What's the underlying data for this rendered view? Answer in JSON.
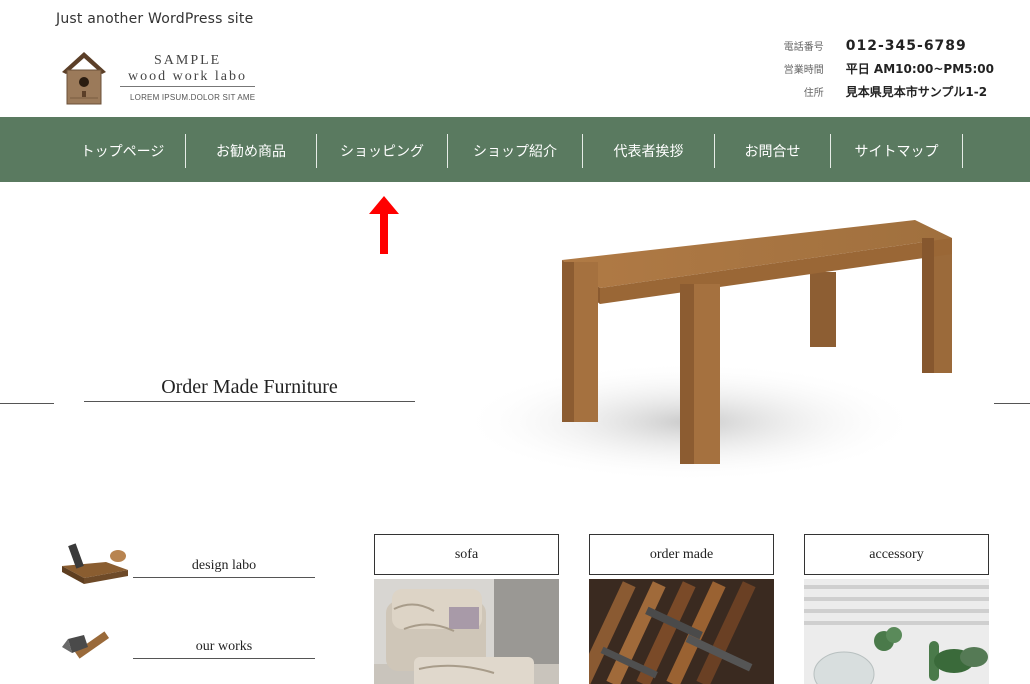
{
  "site": {
    "tagline": "Just another WordPress site",
    "logo": {
      "line1": "SAMPLE",
      "line2": "wood work labo",
      "line3": "LOREM IPSUM.DOLOR SIT AME"
    }
  },
  "contact": {
    "phone_label": "電話番号",
    "phone_value": "012-345-6789",
    "hours_label": "営業時間",
    "hours_value": "平日 AM10:00~PM5:00",
    "address_label": "住所",
    "address_value": "見本県見本市サンプル1-2"
  },
  "nav": {
    "items": [
      {
        "label": "トップページ"
      },
      {
        "label": "お勧め商品"
      },
      {
        "label": "ショッピング"
      },
      {
        "label": "ショップ紹介"
      },
      {
        "label": "代表者挨拶"
      },
      {
        "label": "お問合せ"
      },
      {
        "label": "サイトマップ"
      }
    ]
  },
  "hero": {
    "title": "Order Made Furniture"
  },
  "side_links": [
    {
      "label": "design labo"
    },
    {
      "label": "our works"
    }
  ],
  "categories": [
    {
      "label": "sofa"
    },
    {
      "label": "order made"
    },
    {
      "label": "accessory"
    }
  ],
  "colors": {
    "nav_bg": "#5a7a60",
    "arrow": "#ff0000"
  }
}
